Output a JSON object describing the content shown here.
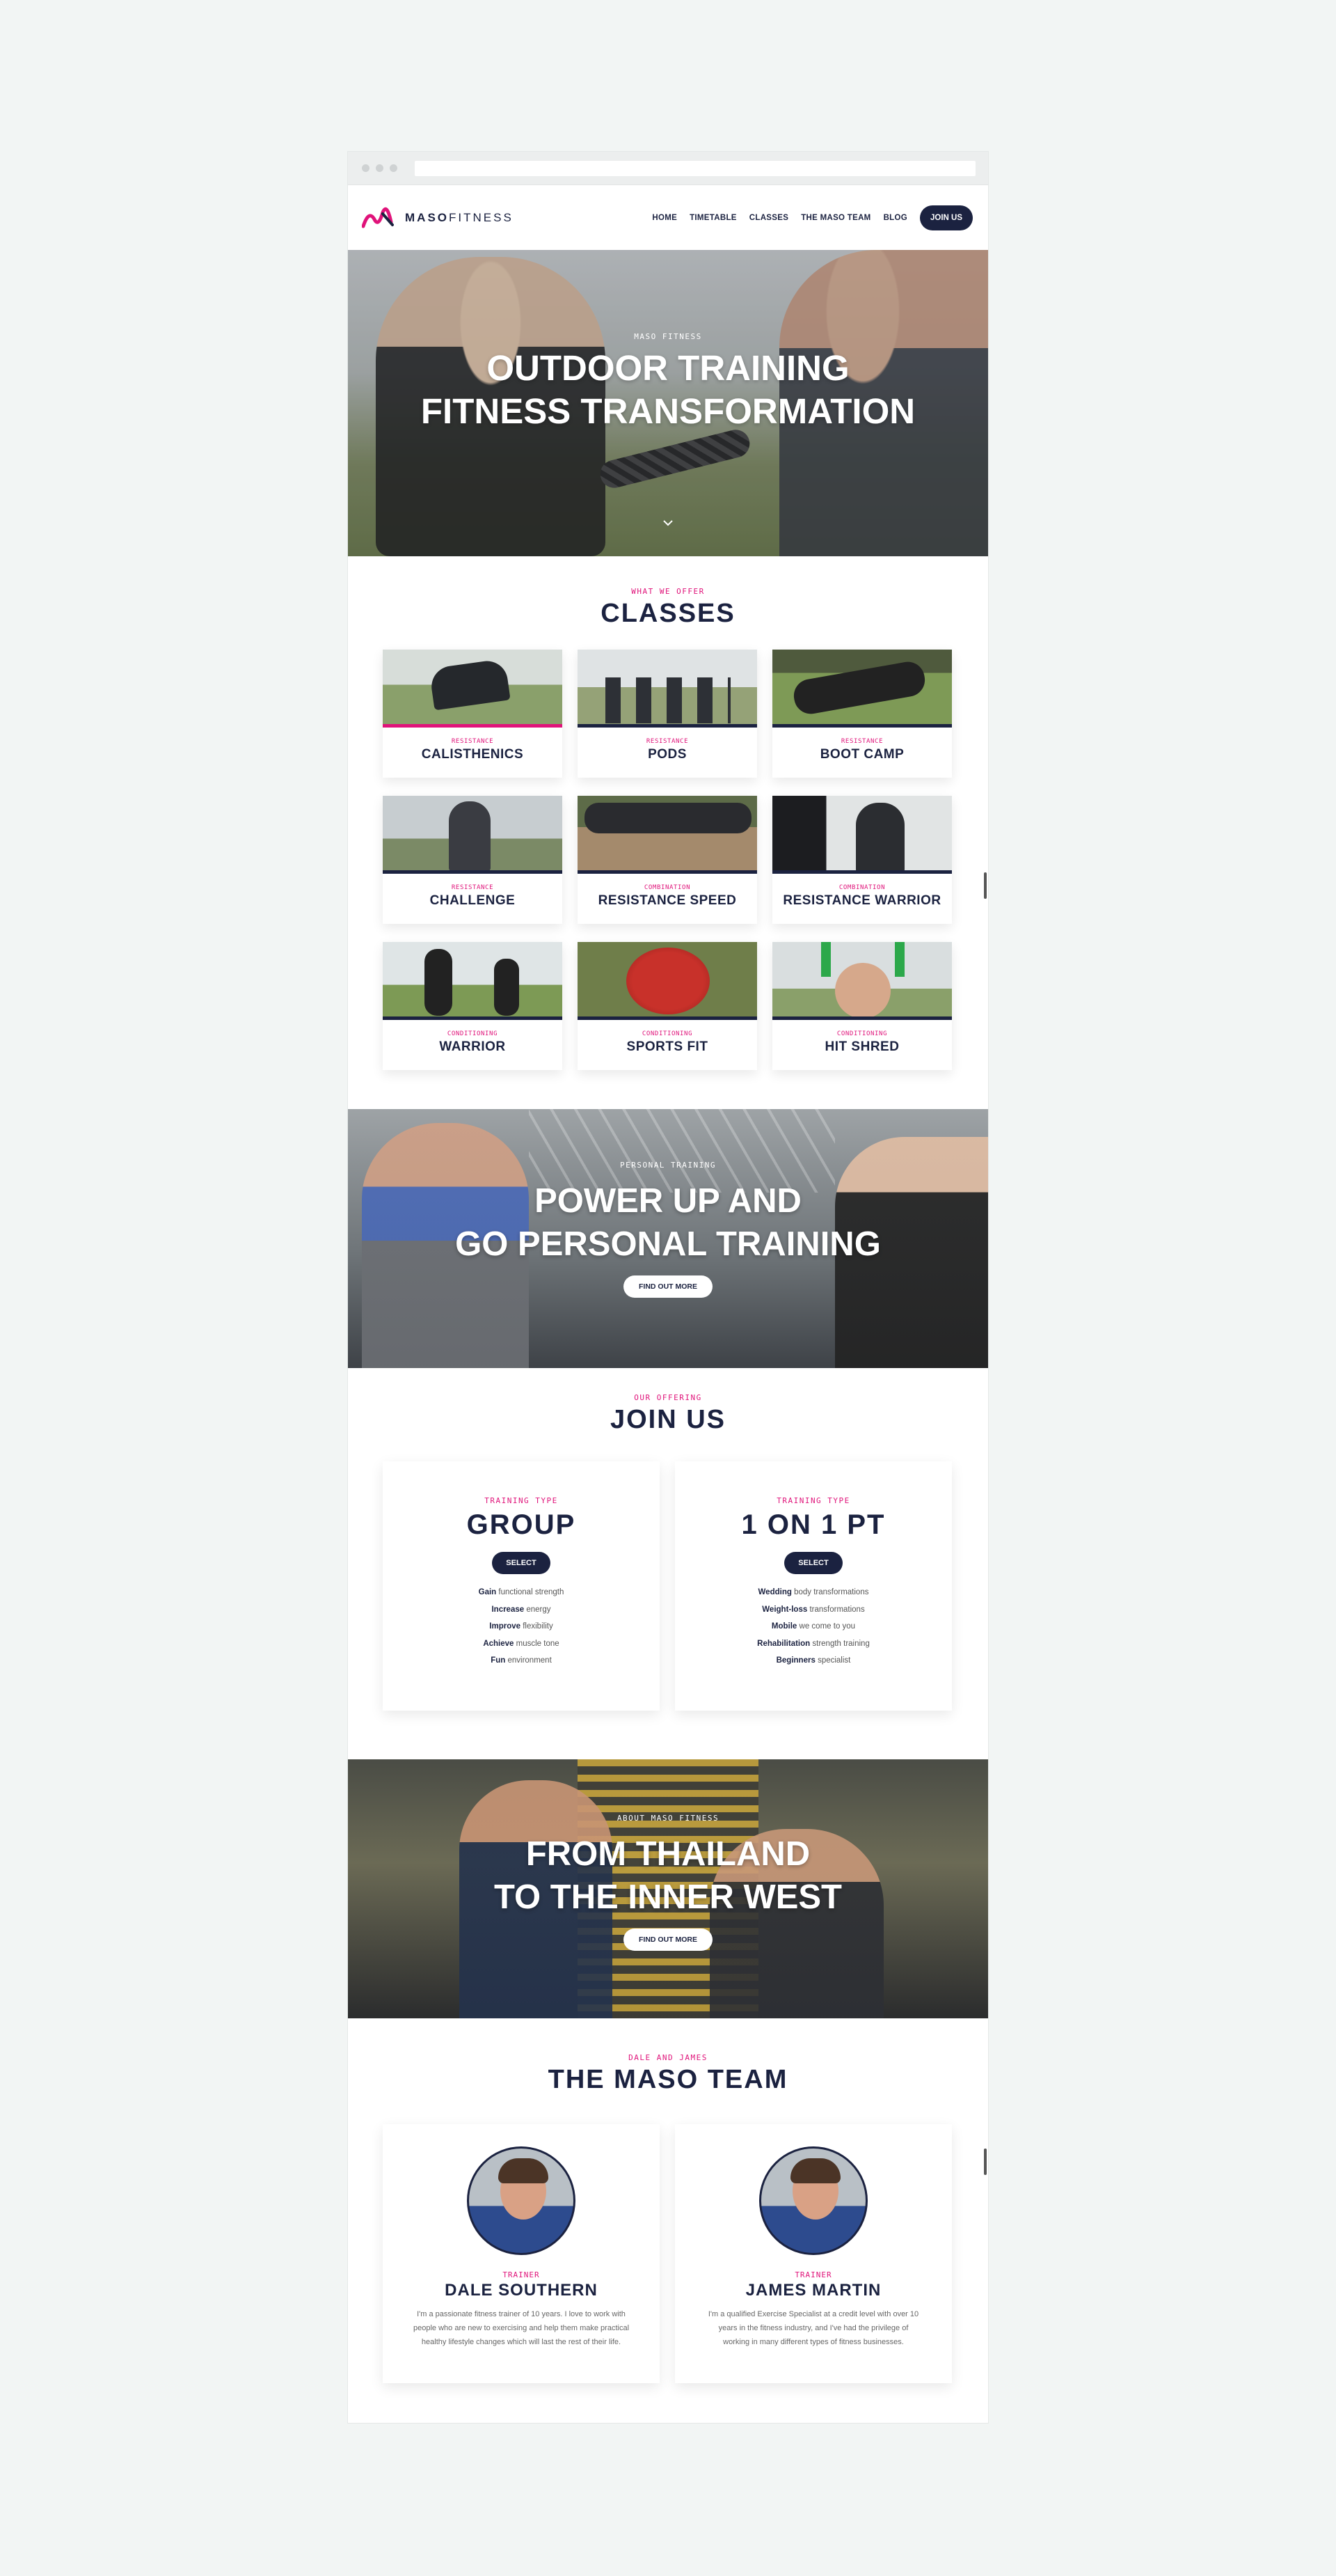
{
  "nav": {
    "logo_bold": "MASO",
    "logo_light": "FITNESS",
    "items": [
      "HOME",
      "TIMETABLE",
      "CLASSES",
      "THE MASO TEAM",
      "BLOG"
    ],
    "cta": "JOIN US"
  },
  "hero": {
    "kicker": "MASO FITNESS",
    "title_line1": "OUTDOOR TRAINING",
    "title_line2": "FITNESS TRANSFORMATION"
  },
  "classes": {
    "kicker": "WHAT WE OFFER",
    "title": "CLASSES",
    "items": [
      {
        "category": "RESISTANCE",
        "name": "CALISTHENICS"
      },
      {
        "category": "RESISTANCE",
        "name": "PODS"
      },
      {
        "category": "RESISTANCE",
        "name": "BOOT CAMP"
      },
      {
        "category": "RESISTANCE",
        "name": "CHALLENGE"
      },
      {
        "category": "COMBINATION",
        "name": "RESISTANCE SPEED"
      },
      {
        "category": "COMBINATION",
        "name": "RESISTANCE WARRIOR"
      },
      {
        "category": "CONDITIONING",
        "name": "WARRIOR"
      },
      {
        "category": "CONDITIONING",
        "name": "SPORTS FIT"
      },
      {
        "category": "CONDITIONING",
        "name": "HIT SHRED"
      }
    ]
  },
  "personal": {
    "kicker": "PERSONAL TRAINING",
    "title_line1": "POWER UP AND",
    "title_line2": "GO PERSONAL TRAINING",
    "button": "FIND OUT MORE"
  },
  "join": {
    "kicker": "OUR OFFERING",
    "title": "JOIN US",
    "plans": [
      {
        "type_label": "TRAINING TYPE",
        "title": "GROUP",
        "button": "SELECT",
        "features": [
          {
            "bold": "Gain",
            "rest": "functional strength"
          },
          {
            "bold": "Increase",
            "rest": "energy"
          },
          {
            "bold": "Improve",
            "rest": "flexibility"
          },
          {
            "bold": "Achieve",
            "rest": "muscle tone"
          },
          {
            "bold": "Fun",
            "rest": "environment"
          }
        ]
      },
      {
        "type_label": "TRAINING TYPE",
        "title": "1 ON 1 PT",
        "button": "SELECT",
        "features": [
          {
            "bold": "Wedding",
            "rest": "body transformations"
          },
          {
            "bold": "Weight-loss",
            "rest": "transformations"
          },
          {
            "bold": "Mobile",
            "rest": "we come to you"
          },
          {
            "bold": "Rehabilitation",
            "rest": "strength training"
          },
          {
            "bold": "Beginners",
            "rest": "specialist"
          }
        ]
      }
    ]
  },
  "about": {
    "kicker": "ABOUT MASO FITNESS",
    "title_line1": "FROM THAILAND",
    "title_line2": "TO THE INNER WEST",
    "button": "FIND OUT MORE"
  },
  "team": {
    "kicker": "DALE AND JAMES",
    "title": "THE MASO TEAM",
    "trainers": [
      {
        "role": "TRAINER",
        "name": "DALE SOUTHERN",
        "bio": "I'm a passionate fitness trainer of 10 years. I love to work with people who are new to exercising and help them make practical healthy lifestyle changes which will last the rest of their life."
      },
      {
        "role": "TRAINER",
        "name": "JAMES MARTIN",
        "bio": "I'm a qualified Exercise Specialist at a credit level with over 10 years in the fitness industry, and I've had the privilege of working in many different types of fitness businesses."
      }
    ]
  },
  "colors": {
    "navy": "#1b2240",
    "accent_pink": "#e0137a",
    "page_bg": "#f2f5f4"
  },
  "icons": {
    "hero_scroll": "chevron-down-icon",
    "logo": "maso-logo-mark-icon"
  }
}
